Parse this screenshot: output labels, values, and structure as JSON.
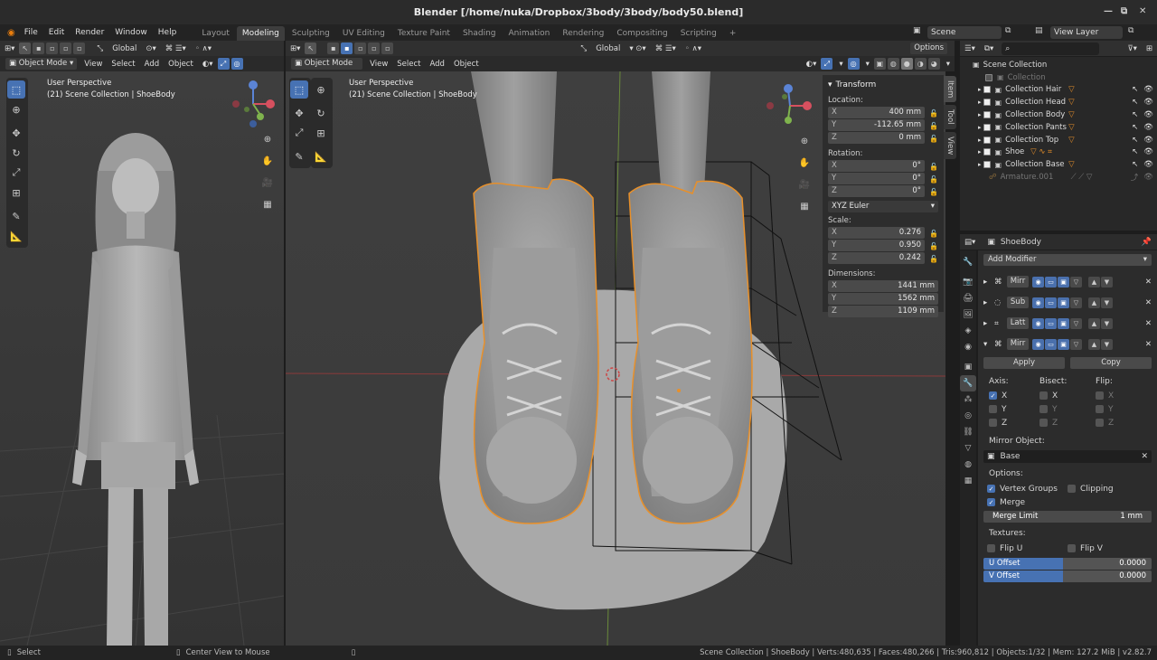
{
  "window": {
    "title": "Blender [/home/nuka/Dropbox/3body/3body/body50.blend]"
  },
  "menu": [
    "File",
    "Edit",
    "Render",
    "Window",
    "Help"
  ],
  "workspaces": [
    "Layout",
    "Modeling",
    "Sculpting",
    "UV Editing",
    "Texture Paint",
    "Shading",
    "Animation",
    "Rendering",
    "Compositing",
    "Scripting"
  ],
  "active_workspace": "Modeling",
  "scene_field": "Scene",
  "view_layer_field": "View Layer",
  "left_view": {
    "orientation": "Global",
    "mode": "Object Mode",
    "menus": [
      "View",
      "Select",
      "Add",
      "Object"
    ],
    "info_line1": "User Perspective",
    "info_line2": "(21) Scene Collection | ShoeBody"
  },
  "main_view": {
    "orientation": "Global",
    "options": "Options",
    "mode": "Object Mode",
    "menus": [
      "View",
      "Select",
      "Add",
      "Object"
    ],
    "info_line1": "User Perspective",
    "info_line2": "(21) Scene Collection | ShoeBody"
  },
  "npanel": {
    "section": "Transform",
    "location_label": "Location:",
    "location": [
      {
        "axis": "X",
        "value": "400 mm"
      },
      {
        "axis": "Y",
        "value": "-112.65 mm"
      },
      {
        "axis": "Z",
        "value": "0 mm"
      }
    ],
    "rotation_label": "Rotation:",
    "rotation": [
      {
        "axis": "X",
        "value": "0°"
      },
      {
        "axis": "Y",
        "value": "0°"
      },
      {
        "axis": "Z",
        "value": "0°"
      }
    ],
    "rotation_mode": "XYZ Euler",
    "scale_label": "Scale:",
    "scale": [
      {
        "axis": "X",
        "value": "0.276"
      },
      {
        "axis": "Y",
        "value": "0.950"
      },
      {
        "axis": "Z",
        "value": "0.242"
      }
    ],
    "dimensions_label": "Dimensions:",
    "dimensions": [
      {
        "axis": "X",
        "value": "1441 mm"
      },
      {
        "axis": "Y",
        "value": "1562 mm"
      },
      {
        "axis": "Z",
        "value": "1109 mm"
      }
    ],
    "tabs": [
      "Item",
      "Tool",
      "View"
    ]
  },
  "outliner": {
    "root": "Scene Collection",
    "items": [
      {
        "name": "Collection",
        "dim": true
      },
      {
        "name": "Collection Hair",
        "dim": false
      },
      {
        "name": "Collection Head",
        "dim": false
      },
      {
        "name": "Collection Body",
        "dim": false
      },
      {
        "name": "Collection Pants",
        "dim": false
      },
      {
        "name": "Collection Top",
        "dim": false
      },
      {
        "name": "Shoe",
        "dim": false
      },
      {
        "name": "Collection Base",
        "dim": false
      },
      {
        "name": "Armature.001",
        "dim": true
      }
    ]
  },
  "properties": {
    "object_name": "ShoeBody",
    "add_modifier": "Add Modifier",
    "modifiers": [
      "Mirr",
      "Sub",
      "Latt",
      "Mirr"
    ],
    "apply": "Apply",
    "copy": "Copy",
    "axis_label": "Axis:",
    "bisect_label": "Bisect:",
    "flip_label": "Flip:",
    "axes": [
      "X",
      "Y",
      "Z"
    ],
    "mirror_object_label": "Mirror Object:",
    "mirror_object": "Base",
    "options_label": "Options:",
    "vertex_groups": "Vertex Groups",
    "clipping": "Clipping",
    "merge": "Merge",
    "merge_limit_label": "Merge Limit",
    "merge_limit": "1 mm",
    "textures_label": "Textures:",
    "flip_u": "Flip U",
    "flip_v": "Flip V",
    "u_offset_label": "U Offset",
    "u_offset": "0.0000",
    "v_offset_label": "V Offset",
    "v_offset": "0.0000"
  },
  "status": {
    "left1": "Select",
    "left2": "Center View to Mouse",
    "right": "Scene Collection | ShoeBody | Verts:480,635 | Faces:480,266 | Tris:960,812 | Objects:1/32 | Mem: 127.2 MiB | v2.82.7"
  }
}
